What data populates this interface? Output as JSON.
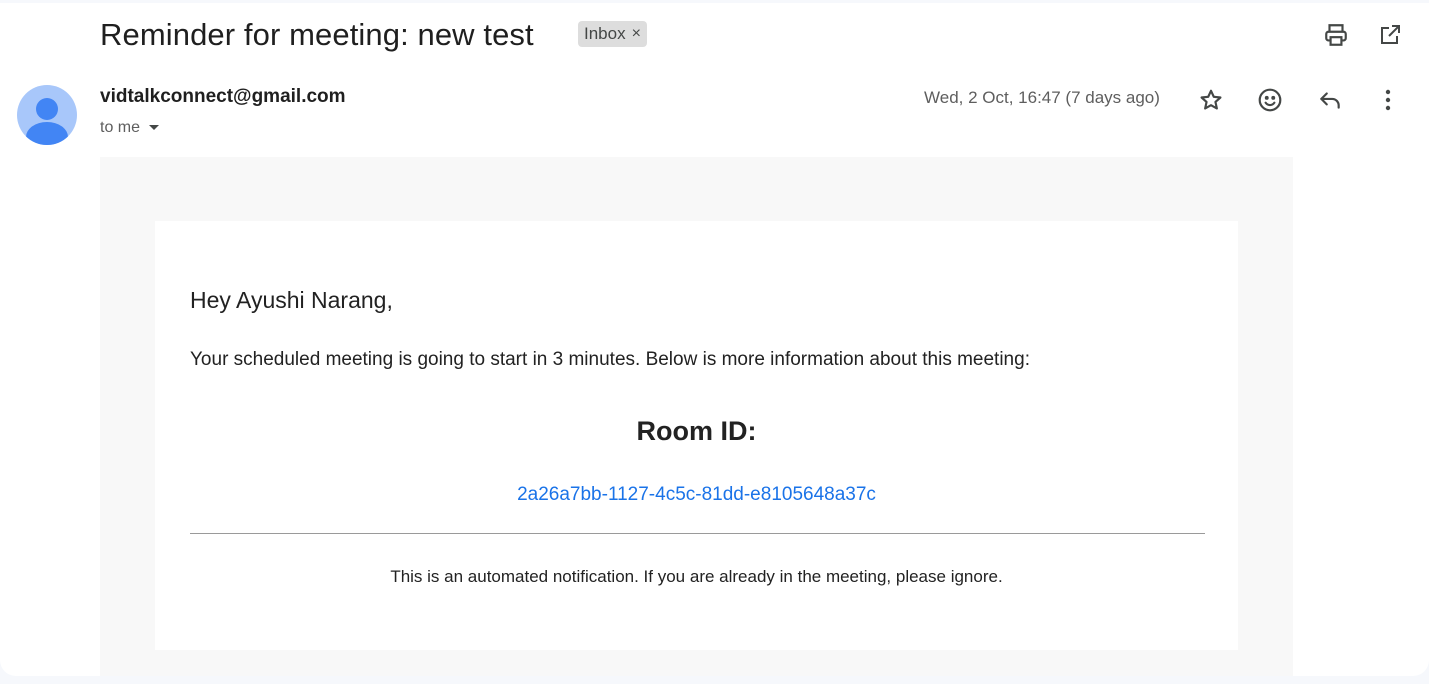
{
  "header": {
    "subject": "Reminder for meeting: new test",
    "label_chip": "Inbox",
    "label_remove": "×",
    "icons": [
      "print-icon",
      "open-in-new-window-icon"
    ]
  },
  "message": {
    "sender": "vidtalkconnect@gmail.com",
    "recipient": "to me",
    "date": "Wed, 2 Oct, 16:47 (7 days ago)",
    "actions": [
      "star-icon",
      "emoji-reaction-icon",
      "reply-icon",
      "more-options-icon"
    ]
  },
  "body": {
    "greeting": "Hey Ayushi Narang,",
    "intro": "Your scheduled meeting is going to start in 3 minutes. Below is more information about this meeting:",
    "room_title": "Room ID:",
    "room_id": "2a26a7bb-1127-4c5c-81dd-e8105648a37c",
    "footer_note": "This is an automated notification. If you are already in the meeting, please ignore."
  },
  "colors": {
    "link": "#1a73e8",
    "avatar_bg": "#a8c7fa",
    "avatar_fg": "#4285f4",
    "chip_bg": "#dddddd"
  }
}
